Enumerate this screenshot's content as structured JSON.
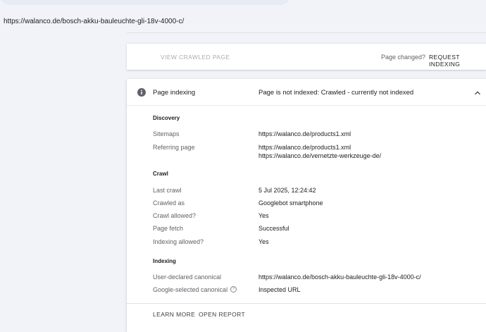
{
  "url_inspected": "https://walanco.de/bosch-akku-bauleuchte-gli-18v-4000-c/",
  "actions": {
    "view_crawled_page": "VIEW CRAWLED PAGE",
    "page_changed": "Page changed?",
    "request_indexing": "REQUEST INDEXING"
  },
  "page_indexing": {
    "title": "Page indexing",
    "status": "Page is not indexed: Crawled - currently not indexed",
    "icon": "info-icon",
    "expanded": true
  },
  "discovery": {
    "title": "Discovery",
    "sitemaps_label": "Sitemaps",
    "sitemaps_value": "https://walanco.de/products1.xml",
    "referring_label": "Referring page",
    "referring_values": [
      "https://walanco.de/products1.xml",
      "https://walanco.de/vernetzte-werkzeuge-de/"
    ]
  },
  "crawl": {
    "title": "Crawl",
    "rows": [
      {
        "label": "Last crawl",
        "value": "5 Jul 2025, 12:24:42"
      },
      {
        "label": "Crawled as",
        "value": "Googlebot smartphone"
      },
      {
        "label": "Crawl allowed?",
        "value": "Yes"
      },
      {
        "label": "Page fetch",
        "value": "Successful"
      },
      {
        "label": "Indexing allowed?",
        "value": "Yes"
      }
    ]
  },
  "indexing": {
    "title": "Indexing",
    "user_canonical_label": "User-declared canonical",
    "user_canonical_value": "https://walanco.de/bosch-akku-bauleuchte-gli-18v-4000-c/",
    "google_canonical_label": "Google-selected canonical",
    "google_canonical_help": "?",
    "google_canonical_value": "Inspected URL"
  },
  "footer": {
    "learn_more": "LEARN MORE",
    "open_report": "OPEN REPORT"
  }
}
